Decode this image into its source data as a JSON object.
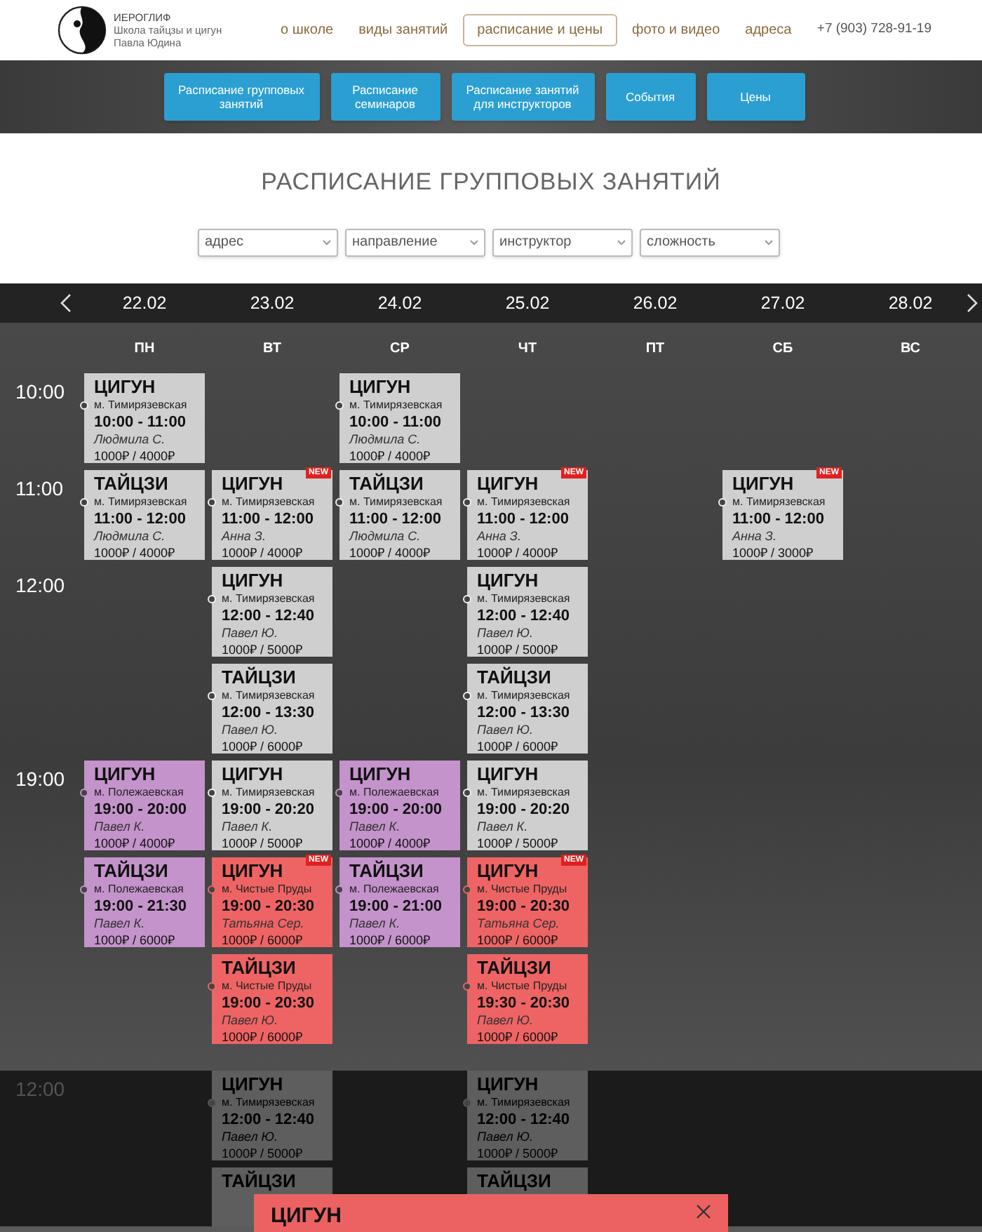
{
  "header": {
    "logo_text": [
      "ИЕРОГЛИФ",
      "Школа тайцзы и цигун",
      "Павла Юдина"
    ],
    "nav": [
      {
        "label": "о школе",
        "selected": false
      },
      {
        "label": "виды занятий",
        "selected": false
      },
      {
        "label": "расписание и цены",
        "selected": true
      },
      {
        "label": "фото и видео",
        "selected": false
      },
      {
        "label": "адреса",
        "selected": false
      }
    ],
    "phone": "+7 (903) 728-91-19"
  },
  "subnav": [
    "Расписание групповых занятий",
    "Расписание семинаров",
    "Расписание занятий для инструкторов",
    "События",
    "Цены"
  ],
  "page_title": "РАСПИСАНИЕ ГРУППОВЫХ ЗАНЯТИЙ",
  "filters": [
    {
      "placeholder": "адрес"
    },
    {
      "placeholder": "направление"
    },
    {
      "placeholder": "инструктор"
    },
    {
      "placeholder": "сложность"
    }
  ],
  "days": [
    {
      "date": "22.02",
      "day": "ПН"
    },
    {
      "date": "23.02",
      "day": "ВТ"
    },
    {
      "date": "24.02",
      "day": "СР"
    },
    {
      "date": "25.02",
      "day": "ЧТ"
    },
    {
      "date": "26.02",
      "day": "ПТ"
    },
    {
      "date": "27.02",
      "day": "СБ"
    },
    {
      "date": "28.02",
      "day": "ВС"
    }
  ],
  "slots": [
    {
      "time": "10:00",
      "rows": [
        [
          {
            "kind": "class",
            "title": "ЦИГУН",
            "location": "м. Тимирязевская",
            "hours": "10:00 - 11:00",
            "teacher": "Людмила С.",
            "price": "1000₽ / 4000₽",
            "color": "#cfcfcf"
          },
          {
            "kind": "empty"
          },
          {
            "kind": "class",
            "title": "ЦИГУН",
            "location": "м. Тимирязевская",
            "hours": "10:00 - 11:00",
            "teacher": "Людмила С.",
            "price": "1000₽ / 4000₽",
            "color": "#cfcfcf"
          },
          {
            "kind": "empty"
          },
          {
            "kind": "empty"
          },
          {
            "kind": "empty"
          },
          {
            "kind": "empty"
          }
        ]
      ]
    },
    {
      "time": "11:00",
      "rows": [
        [
          {
            "kind": "class",
            "title": "ТАЙЦЗИ",
            "location": "м. Тимирязевская",
            "hours": "11:00 - 12:00",
            "teacher": "Людмила С.",
            "price": "1000₽ / 4000₽",
            "color": "#cfcfcf"
          },
          {
            "kind": "class",
            "title": "ЦИГУН",
            "location": "м. Тимирязевская",
            "hours": "11:00 - 12:00",
            "teacher": "Анна З.",
            "price": "1000₽ / 4000₽",
            "color": "#cfcfcf",
            "badge": "NEW"
          },
          {
            "kind": "class",
            "title": "ТАЙЦЗИ",
            "location": "м. Тимирязевская",
            "hours": "11:00 - 12:00",
            "teacher": "Людмила С.",
            "price": "1000₽ / 4000₽",
            "color": "#cfcfcf"
          },
          {
            "kind": "class",
            "title": "ЦИГУН",
            "location": "м. Тимирязевская",
            "hours": "11:00 - 12:00",
            "teacher": "Анна З.",
            "price": "1000₽ / 4000₽",
            "color": "#cfcfcf",
            "badge": "NEW"
          },
          {
            "kind": "empty"
          },
          {
            "kind": "class",
            "title": "ЦИГУН",
            "location": "м. Тимирязевская",
            "hours": "11:00 - 12:00",
            "teacher": "Анна З.",
            "price": "1000₽ / 3000₽",
            "color": "#cfcfcf",
            "badge": "NEW"
          },
          {
            "kind": "empty"
          }
        ]
      ]
    },
    {
      "time": "12:00",
      "rows": [
        [
          {
            "kind": "empty"
          },
          {
            "kind": "class",
            "title": "ЦИГУН",
            "location": "м. Тимирязевская",
            "hours": "12:00 - 12:40",
            "teacher": "Павел Ю.",
            "price": "1000₽ / 5000₽",
            "color": "#cfcfcf"
          },
          {
            "kind": "empty"
          },
          {
            "kind": "class",
            "title": "ЦИГУН",
            "location": "м. Тимирязевская",
            "hours": "12:00 - 12:40",
            "teacher": "Павел Ю.",
            "price": "1000₽ / 5000₽",
            "color": "#cfcfcf"
          },
          {
            "kind": "empty"
          },
          {
            "kind": "empty"
          },
          {
            "kind": "empty"
          }
        ],
        [
          {
            "kind": "empty"
          },
          {
            "kind": "class",
            "title": "ТАЙЦЗИ",
            "location": "м. Тимирязевская",
            "hours": "12:00 - 13:30",
            "teacher": "Павел Ю.",
            "price": "1000₽ / 6000₽",
            "color": "#cfcfcf"
          },
          {
            "kind": "empty"
          },
          {
            "kind": "class",
            "title": "ТАЙЦЗИ",
            "location": "м. Тимирязевская",
            "hours": "12:00 - 13:30",
            "teacher": "Павел Ю.",
            "price": "1000₽ / 6000₽",
            "color": "#cfcfcf"
          },
          {
            "kind": "empty"
          },
          {
            "kind": "empty"
          },
          {
            "kind": "empty"
          }
        ]
      ]
    },
    {
      "time": "19:00",
      "rows": [
        [
          {
            "kind": "class",
            "title": "ЦИГУН",
            "location": "м. Полежаевская",
            "hours": "19:00 - 20:00",
            "teacher": "Павел К.",
            "price": "1000₽ / 4000₽",
            "color": "#c493cb"
          },
          {
            "kind": "class",
            "title": "ЦИГУН",
            "location": "м. Тимирязевская",
            "hours": "19:00 - 20:20",
            "teacher": "Павел К.",
            "price": "1000₽ / 5000₽",
            "color": "#cfcfcf"
          },
          {
            "kind": "class",
            "title": "ЦИГУН",
            "location": "м. Полежаевская",
            "hours": "19:00 - 20:00",
            "teacher": "Павел К.",
            "price": "1000₽ / 4000₽",
            "color": "#c493cb"
          },
          {
            "kind": "class",
            "title": "ЦИГУН",
            "location": "м. Тимирязевская",
            "hours": "19:00 - 20:20",
            "teacher": "Павел К.",
            "price": "1000₽ / 5000₽",
            "color": "#cfcfcf"
          },
          {
            "kind": "empty"
          },
          {
            "kind": "empty"
          },
          {
            "kind": "empty"
          }
        ],
        [
          {
            "kind": "class",
            "title": "ТАЙЦЗИ",
            "location": "м. Полежаевская",
            "hours": "19:00 - 21:30",
            "teacher": "Павел К.",
            "price": "1000₽ / 6000₽",
            "color": "#c493cb"
          },
          {
            "kind": "class",
            "title": "ЦИГУН",
            "location": "м. Чистые Пруды",
            "hours": "19:00 - 20:30",
            "teacher": "Татьяна Сер.",
            "price": "1000₽ / 6000₽",
            "color": "#ee6464",
            "badge": "NEW"
          },
          {
            "kind": "class",
            "title": "ТАЙЦЗИ",
            "location": "м. Полежаевская",
            "hours": "19:00 - 21:00",
            "teacher": "Павел К.",
            "price": "1000₽ / 6000₽",
            "color": "#c493cb"
          },
          {
            "kind": "class",
            "title": "ЦИГУН",
            "location": "м. Чистые Пруды",
            "hours": "19:00 - 20:30",
            "teacher": "Татьяна Сер.",
            "price": "1000₽ / 6000₽",
            "color": "#ee6464",
            "badge": "NEW"
          },
          {
            "kind": "empty"
          },
          {
            "kind": "empty"
          },
          {
            "kind": "empty"
          }
        ],
        [
          {
            "kind": "empty"
          },
          {
            "kind": "class",
            "title": "ТАЙЦЗИ",
            "location": "м. Чистые Пруды",
            "hours": "19:00 - 20:30",
            "teacher": "Павел Ю.",
            "price": "1000₽ / 6000₽",
            "color": "#ee6464"
          },
          {
            "kind": "empty"
          },
          {
            "kind": "class",
            "title": "ТАЙЦЗИ",
            "location": "м. Чистые Пруды",
            "hours": "19:30 - 20:30",
            "teacher": "Павел Ю.",
            "price": "1000₽ / 6000₽",
            "color": "#ee6464"
          },
          {
            "kind": "empty"
          },
          {
            "kind": "empty"
          },
          {
            "kind": "empty"
          }
        ]
      ]
    }
  ],
  "dimmed_slot": {
    "time": "12:00",
    "rows": [
      [
        {
          "kind": "empty"
        },
        {
          "kind": "class",
          "title": "ЦИГУН",
          "location": "м. Тимирязевская",
          "hours": "12:00 - 12:40",
          "teacher": "Павел Ю.",
          "price": "1000₽ / 5000₽"
        },
        {
          "kind": "empty"
        },
        {
          "kind": "class",
          "title": "ЦИГУН",
          "location": "м. Тимирязевская",
          "hours": "12:00 - 12:40",
          "teacher": "Павел Ю.",
          "price": "1000₽ / 5000₽"
        },
        {
          "kind": "empty"
        },
        {
          "kind": "empty"
        },
        {
          "kind": "empty"
        }
      ],
      [
        {
          "kind": "empty"
        },
        {
          "kind": "class",
          "title": "ТАЙЦЗИ"
        },
        {
          "kind": "empty"
        },
        {
          "kind": "class",
          "title": "ТАЙЦЗИ"
        },
        {
          "kind": "empty"
        },
        {
          "kind": "empty"
        },
        {
          "kind": "empty"
        }
      ]
    ]
  },
  "modal": {
    "title": "ЦИГУН"
  }
}
